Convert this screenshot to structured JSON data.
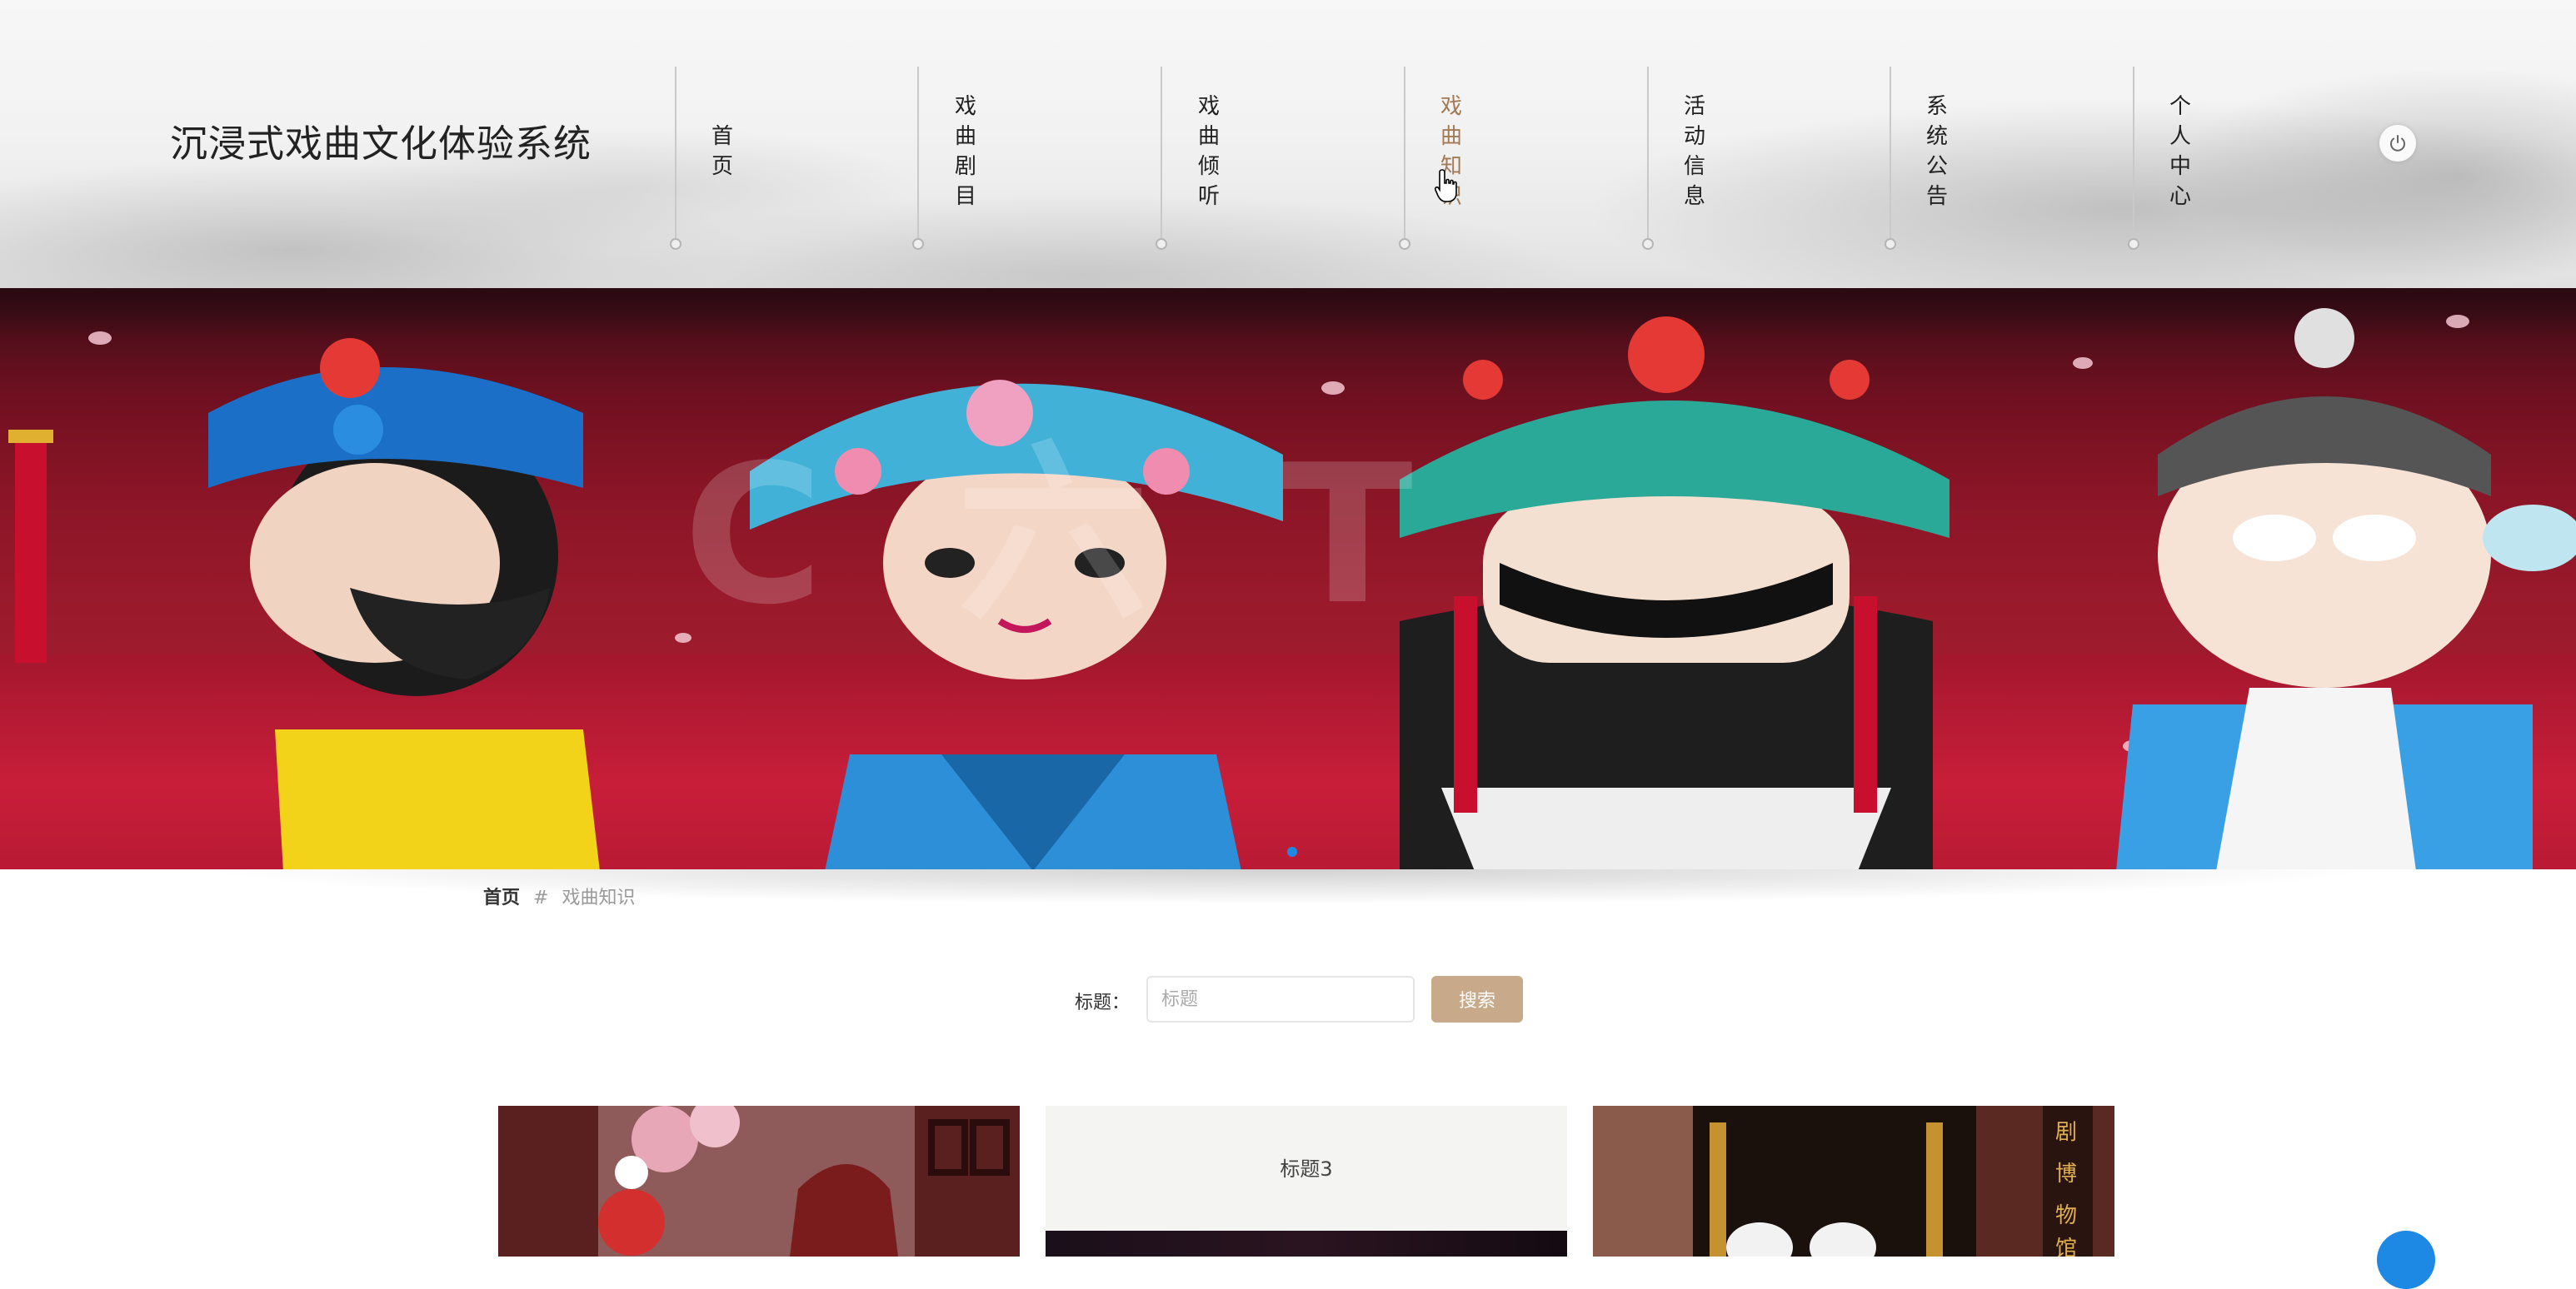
{
  "header": {
    "site_title": "沉浸式戏曲文化体验系统",
    "nav": [
      {
        "label": "首页",
        "active": false
      },
      {
        "label": "戏曲剧目",
        "active": false
      },
      {
        "label": "戏曲倾听",
        "active": false
      },
      {
        "label": "戏曲知识",
        "active": true
      },
      {
        "label": "活动信息",
        "active": false
      },
      {
        "label": "系统公告",
        "active": false
      },
      {
        "label": "个人中心",
        "active": false
      }
    ],
    "power_icon": "power-icon",
    "active_color": "#a47a55"
  },
  "banner": {
    "carousel_indicator_color": "#1e88e5",
    "slides_visible": 1
  },
  "breadcrumb": {
    "home": "首页",
    "separator": "#",
    "current": "戏曲知识"
  },
  "search": {
    "label": "标题：",
    "placeholder": "标题",
    "value": "",
    "button_label": "搜索",
    "button_color": "#c8a98a"
  },
  "cards": [
    {
      "title": ""
    },
    {
      "title": "标题3"
    },
    {
      "title": ""
    }
  ]
}
